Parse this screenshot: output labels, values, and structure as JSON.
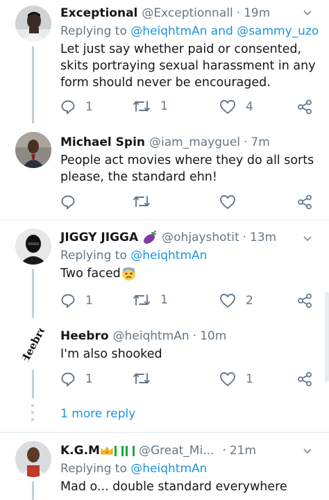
{
  "tweets": [
    {
      "name": "Exceptional",
      "handle": "@Exceptionnall",
      "time": "19m",
      "reply_prefix": "Replying to",
      "reply_links": "@heiqhtmAn and @sammy_uzo",
      "text": "Let just say whether paid or consented, skits portraying sexual harassment in any form should never be encouraged.",
      "replies": "1",
      "retweets": "1",
      "likes": "4"
    },
    {
      "name": "Michael Spin",
      "handle": "@iam_mayguel",
      "time": "7m",
      "text": "People act movies where they do all sorts please, the standard ehn!"
    },
    {
      "name": "JIGGY JIGGA",
      "name_emoji": "eggplant",
      "handle": "@ohjayshotit",
      "time": "13m",
      "reply_prefix": "Replying to",
      "reply_links": "@heiqhtmAn",
      "text": "Two faced",
      "text_emoji": "anxious-face",
      "replies": "1",
      "retweets": "1",
      "likes": "2"
    },
    {
      "name": "Heebro",
      "handle": "@heiqhtmAn",
      "time": "10m",
      "text": "I'm also shooked",
      "replies": "1",
      "likes": "1"
    },
    {
      "name": "K.G.M",
      "name_emoji": "crown-and-nigeria-flags",
      "handle": "@Great_Mi...",
      "time": "21m",
      "reply_prefix": "Replying to",
      "reply_links": "@heiqhtmAn",
      "text": "Mad o... double standard everywhere"
    }
  ],
  "more_replies": "1 more reply",
  "separator": "·",
  "colors": {
    "link": "#1b95e0",
    "muted": "#657786",
    "text": "#14171a",
    "divider": "#e1e8ed"
  }
}
